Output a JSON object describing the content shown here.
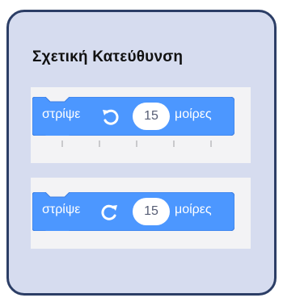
{
  "title": "Σχετική Κατεύθυνση",
  "blocks": [
    {
      "label": "στρίψε",
      "icon": "rotate-counterclockwise-icon",
      "value": "15",
      "unit": "μοίρες"
    },
    {
      "label": "στρίψε",
      "icon": "rotate-clockwise-icon",
      "value": "15",
      "unit": "μοίρες"
    }
  ],
  "colors": {
    "block": "#4c97ff",
    "card": "#d6dcef",
    "border": "#2c3e66"
  }
}
